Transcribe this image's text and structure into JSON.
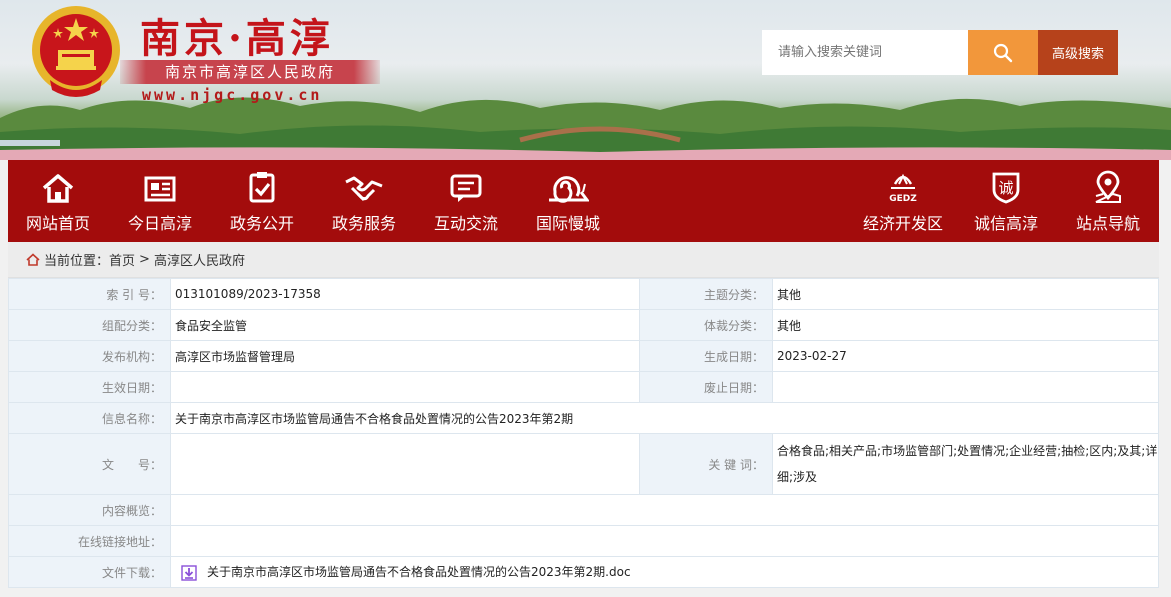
{
  "header": {
    "title": "南京·高淳",
    "subtitle": "南京市高淳区人民政府",
    "url": "www.njgc.gov.cn"
  },
  "search": {
    "placeholder": "请输入搜索关键词",
    "advanced_label": "高级搜索",
    "button_icon": "search-icon"
  },
  "nav": {
    "left": [
      {
        "label": "网站首页",
        "icon": "home-icon"
      },
      {
        "label": "今日高淳",
        "icon": "newspaper-icon"
      },
      {
        "label": "政务公开",
        "icon": "checklist-icon"
      },
      {
        "label": "政务服务",
        "icon": "handshake-icon"
      },
      {
        "label": "互动交流",
        "icon": "chat-icon"
      },
      {
        "label": "国际慢城",
        "icon": "snail-icon"
      }
    ],
    "right": [
      {
        "label": "经济开发区",
        "icon": "gedz-logo-icon",
        "logo_text": "GEDZ"
      },
      {
        "label": "诚信高淳",
        "icon": "integrity-badge-icon",
        "badge_text": "诚"
      },
      {
        "label": "站点导航",
        "icon": "location-pin-icon"
      }
    ]
  },
  "breadcrumb": {
    "prefix": "当前位置：",
    "items": [
      "首页",
      "高淳区人民政府"
    ],
    "separator": ">"
  },
  "info": {
    "index_label": "索 引 号：",
    "index_value": "013101089/2023-17358",
    "topic_label": "主题分类：",
    "topic_value": "其他",
    "category_label": "组配分类：",
    "category_value": "食品安全监管",
    "genre_label": "体裁分类：",
    "genre_value": "其他",
    "publisher_label": "发布机构：",
    "publisher_value": "高淳区市场监督管理局",
    "created_label": "生成日期：",
    "created_value": "2023-02-27",
    "effective_label": "生效日期：",
    "effective_value": "",
    "expired_label": "废止日期：",
    "expired_value": "",
    "name_label": "信息名称：",
    "name_value": "关于南京市高淳区市场监管局通告不合格食品处置情况的公告2023年第2期",
    "docno_label": "文　　号：",
    "docno_value": "",
    "keywords_label": "关 键 词：",
    "keywords_value": "合格食品;相关产品;市场监管部门;处置情况;企业经营;抽检;区内;及其;详细;涉及",
    "summary_label": "内容概览：",
    "summary_value": "",
    "link_label": "在线链接地址：",
    "link_value": "",
    "download_label": "文件下载：",
    "download_value": "关于南京市高淳区市场监管局通告不合格食品处置情况的公告2023年第2期.doc"
  },
  "colors": {
    "nav_bg": "#a30c0c",
    "search_button": "#f2973b",
    "advanced_button": "#b6421b",
    "title_red": "#c4141a",
    "table_key_bg": "#edf3f9",
    "download_icon": "#8a4fd9"
  }
}
